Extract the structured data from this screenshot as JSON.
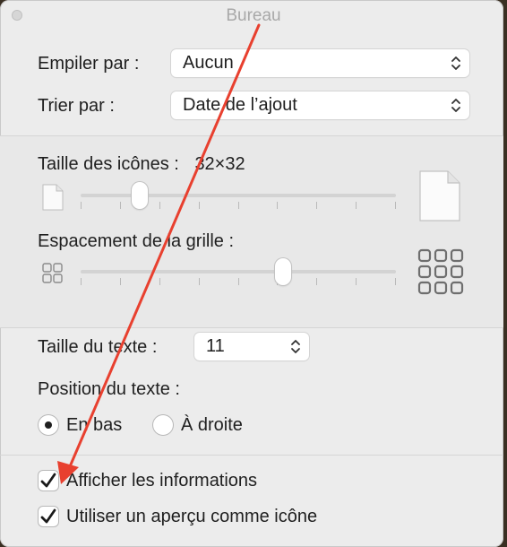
{
  "window": {
    "title": "Bureau"
  },
  "stack": {
    "label": "Empiler par :",
    "value": "Aucun"
  },
  "sort": {
    "label": "Trier par :",
    "value": "Date de l’ajout"
  },
  "icon_size": {
    "label": "Taille des icônes :",
    "value": "32×32",
    "level": 0.17
  },
  "grid_spacing": {
    "label": "Espacement de la grille :",
    "level": 0.65
  },
  "text_size": {
    "label": "Taille du texte :",
    "value": "11"
  },
  "text_position": {
    "label": "Position du texte :",
    "options": [
      {
        "label": "En bas",
        "selected": true
      },
      {
        "label": "À droite",
        "selected": false
      }
    ]
  },
  "show_info": {
    "label": "Afficher les informations",
    "checked": true
  },
  "use_preview": {
    "label": "Utiliser un aperçu comme icône",
    "checked": true
  },
  "colors": {
    "annotation_arrow": "#e8402f",
    "window_bg": "#ececec"
  }
}
